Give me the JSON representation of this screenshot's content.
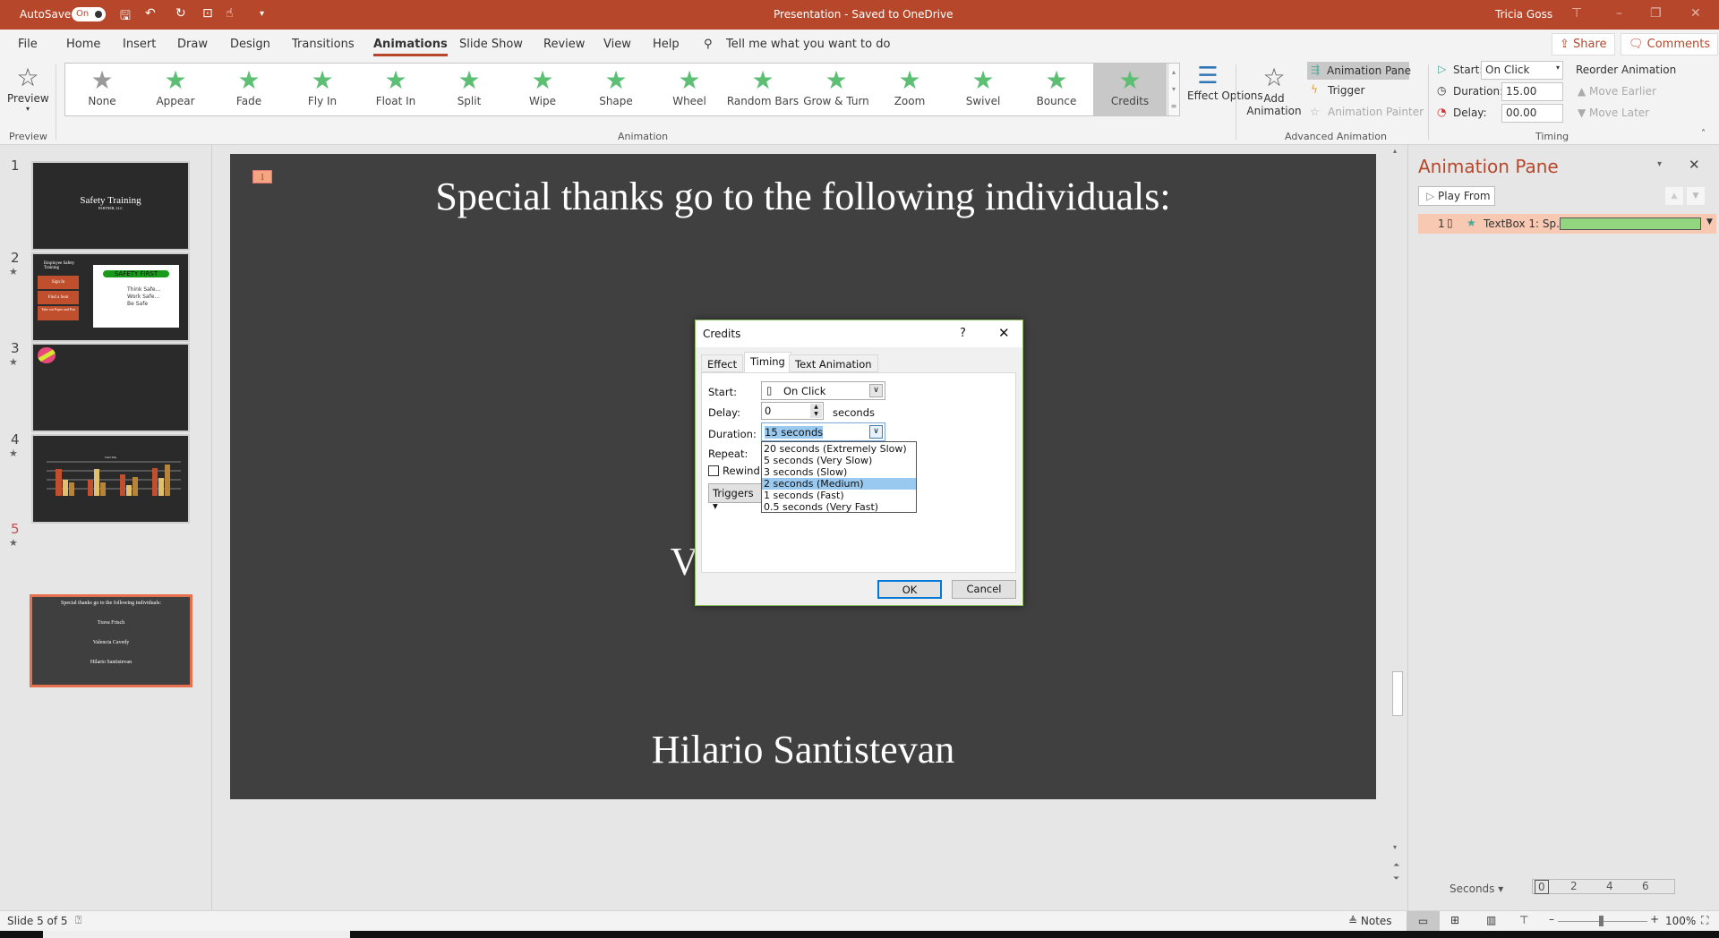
{
  "titlebar": {
    "autosave": "AutoSave",
    "autosave_state": "On",
    "title": "Presentation  -  Saved to OneDrive",
    "title_caret": "▾",
    "user": "Tricia Goss"
  },
  "tabs": [
    "File",
    "Home",
    "Insert",
    "Draw",
    "Design",
    "Transitions",
    "Animations",
    "Slide Show",
    "Review",
    "View",
    "Help"
  ],
  "active_tab": "Animations",
  "search_placeholder": "Tell me what you want to do",
  "share": "Share",
  "comments": "Comments",
  "ribbon": {
    "preview": "Preview",
    "preview_group": "Preview",
    "animations": [
      "None",
      "Appear",
      "Fade",
      "Fly In",
      "Float In",
      "Split",
      "Wipe",
      "Shape",
      "Wheel",
      "Random Bars",
      "Grow & Turn",
      "Zoom",
      "Swivel",
      "Bounce",
      "Credits"
    ],
    "selected_animation": "Credits",
    "effect_options": "Effect Options",
    "animation_group": "Animation",
    "add_animation": "Add Animation",
    "animation_pane": "Animation Pane",
    "trigger": "Trigger",
    "animation_painter": "Animation Painter",
    "advanced_group": "Advanced Animation",
    "start_label": "Start:",
    "start_value": "On Click",
    "duration_label": "Duration:",
    "duration_value": "15.00",
    "delay_label": "Delay:",
    "delay_value": "00.00",
    "reorder": "Reorder Animation",
    "move_earlier": "Move Earlier",
    "move_later": "Move Later",
    "timing_group": "Timing"
  },
  "thumbnails": [
    {
      "num": "1",
      "title": "Safety Training",
      "subtitle": "PARTNER, LLC"
    },
    {
      "num": "2",
      "title": "Employee Safety Training",
      "items": [
        "Sign In",
        "Find a Seat",
        "Take out Paper and Pen"
      ],
      "badge": "SAFETY FIRST",
      "lines": [
        "Think Safe...",
        "Work Safe...",
        "Be Safe"
      ]
    },
    {
      "num": "3"
    },
    {
      "num": "4",
      "title": "Chart Title"
    },
    {
      "num": "5",
      "title": "Special thanks go to the following individuals:",
      "names": [
        "Trava Frisch",
        "Valencia Cavedy",
        "Hilario Santistevan"
      ]
    }
  ],
  "slide": {
    "tag": "1",
    "title": "Special thanks go to the following individuals:",
    "names": [
      "Trava Frisch",
      "Valencia Cavedy",
      "Hilario Santistevan"
    ]
  },
  "dialog": {
    "title": "Credits",
    "help": "?",
    "tabs": [
      "Effect",
      "Timing",
      "Text Animation"
    ],
    "active_tab": "Timing",
    "start_label": "Start:",
    "start_value": "On Click",
    "delay_label": "Delay:",
    "delay_value": "0",
    "delay_unit": "seconds",
    "duration_label": "Duration:",
    "duration_value": "15 seconds",
    "repeat_label": "Repeat:",
    "rewind_label": "Rewind",
    "triggers": "Triggers",
    "duration_options": [
      "20 seconds (Extremely Slow)",
      "5 seconds (Very Slow)",
      "3 seconds (Slow)",
      "2 seconds (Medium)",
      "1 seconds (Fast)",
      "0.5 seconds (Very Fast)"
    ],
    "highlighted_option": "2 seconds (Medium)",
    "ok": "OK",
    "cancel": "Cancel"
  },
  "animation_pane": {
    "title": "Animation Pane",
    "play_from": "Play From",
    "item": {
      "num": "1",
      "label": "TextBox 1: Sp..."
    },
    "seconds": "Seconds",
    "ticks": [
      "0",
      "2",
      "4",
      "6"
    ]
  },
  "statusbar": {
    "slide": "Slide 5 of 5",
    "notes": "Notes",
    "zoom": "100%"
  },
  "colors": {
    "accent": "#b7472a",
    "animation_bar": "#92d67f",
    "highlight": "#99c9ef"
  }
}
